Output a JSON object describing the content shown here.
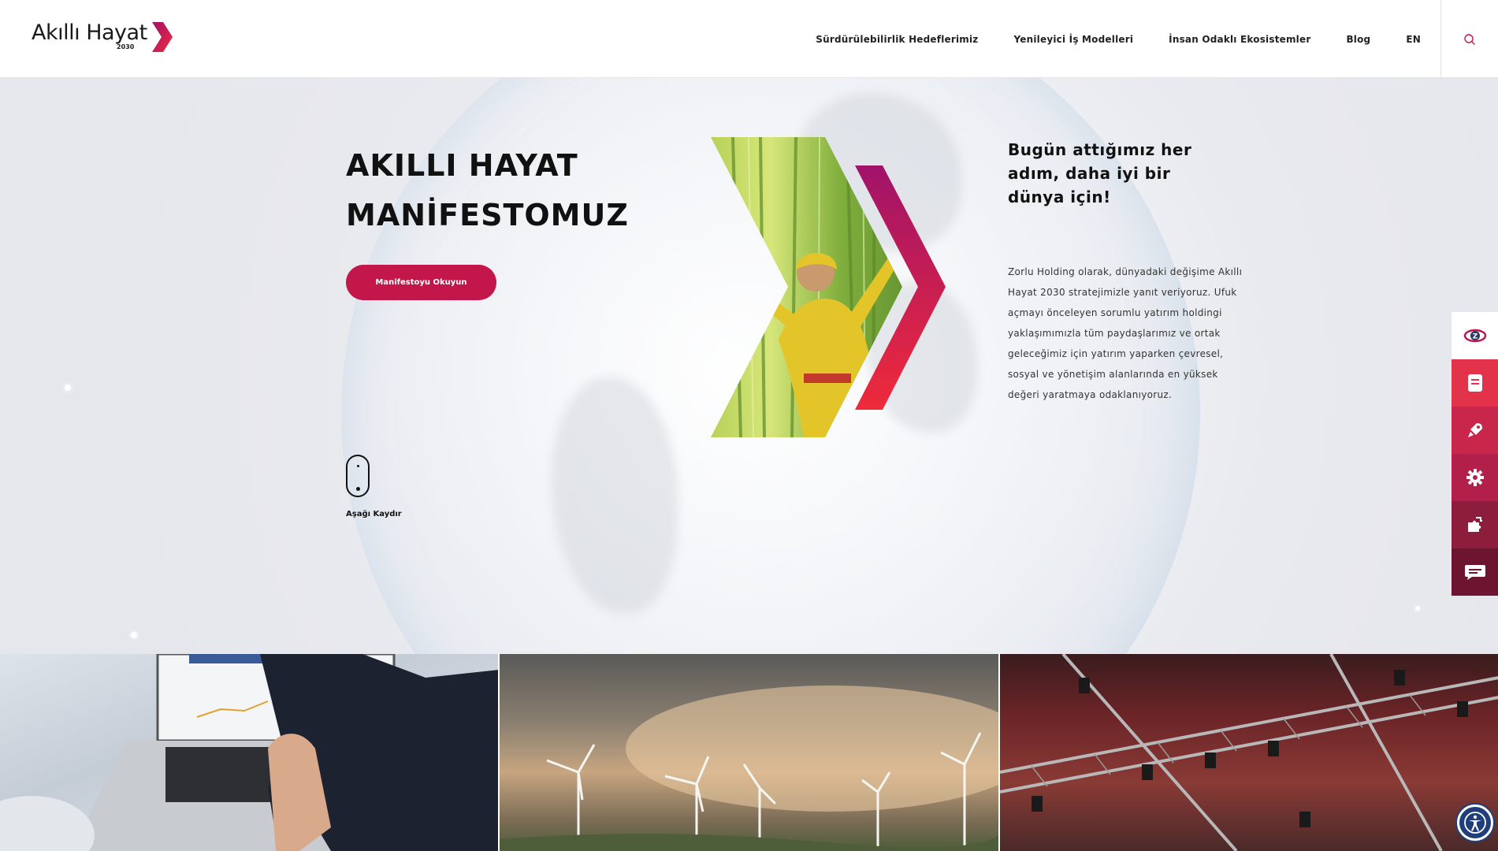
{
  "header": {
    "logo_text": "Akıllı Hayat",
    "logo_year": "2030",
    "nav": [
      {
        "label": "Sürdürülebilirlik Hedeflerimiz"
      },
      {
        "label": "Yenileyici İş Modelleri"
      },
      {
        "label": "İnsan Odaklı Ekosistemler"
      },
      {
        "label": "Blog"
      },
      {
        "label": "EN"
      }
    ],
    "search_icon": "search-icon"
  },
  "hero": {
    "title_line1": "AKILLI HAYAT",
    "title_line2": "MANİFESTOMUZ",
    "cta_label": "Manifestoyu Okuyun",
    "scroll_label": "Aşağı Kaydır",
    "tagline": "Bugün attığımız her adım, daha iyi bir dünya için!",
    "body": "Zorlu Holding olarak, dünyadaki değişime Akıllı Hayat 2030 stratejimizle yanıt veriyoruz. Ufuk açmayı önceleyen sorumlu yatırım holdingi yaklaşımımızla tüm paydaşlarımız ve ortak geleceğimiz için yatırım yaparken çevresel, sosyal ve yönetişim alanlarında en yüksek değeri yaratmaya odaklanıyoruz."
  },
  "side_bar": [
    {
      "icon": "zorlu-logo-icon",
      "color": "#ffffff"
    },
    {
      "icon": "document-icon",
      "color": "#e2334a"
    },
    {
      "icon": "rocket-icon",
      "color": "#c8264b"
    },
    {
      "icon": "gear-icon",
      "color": "#b11f4a"
    },
    {
      "icon": "puzzle-icon",
      "color": "#8c1d3c"
    },
    {
      "icon": "chat-icon",
      "color": "#6d1530"
    }
  ],
  "tiles": [
    {
      "image": "laptop-hand-image"
    },
    {
      "image": "wind-turbines-image"
    },
    {
      "image": "stage-lighting-truss-image"
    }
  ],
  "accessibility_icon": "accessibility-icon",
  "colors": {
    "brand_primary": "#c3164a",
    "brand_gradient_start": "#a0136a",
    "brand_gradient_end": "#ef2a3a"
  }
}
